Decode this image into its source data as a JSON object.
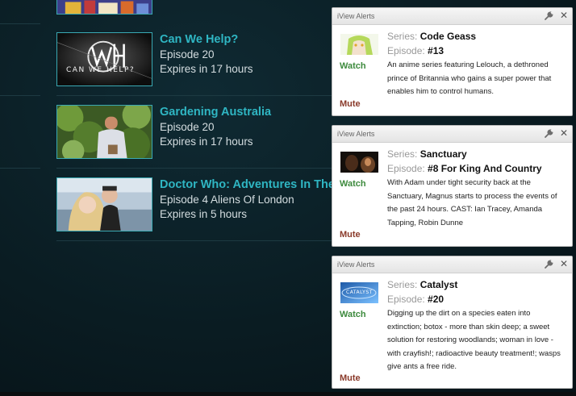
{
  "shows": [
    {
      "title": "",
      "episode": "",
      "expires": ""
    },
    {
      "title": "Can We Help?",
      "episode": "Episode 20",
      "expires": "Expires in 17 hours",
      "thumb_text": "CAN WE HELP?"
    },
    {
      "title": "Gardening Australia",
      "episode": "Episode 20",
      "expires": "Expires in 17 hours"
    },
    {
      "title": "Doctor Who: Adventures In The",
      "episode": "Episode 4 Aliens Of London",
      "expires": "Expires in 5 hours"
    }
  ],
  "alerts": [
    {
      "header": "iView Alerts",
      "series_label": "Series:",
      "series": "Code Geass",
      "episode_label": "Episode:",
      "episode": "#13",
      "watch": "Watch",
      "mute": "Mute",
      "description": "An anime series featuring Lelouch, a dethroned prince of Britannia who gains a super power that enables him to control humans."
    },
    {
      "header": "iView Alerts",
      "series_label": "Series:",
      "series": "Sanctuary",
      "episode_label": "Episode:",
      "episode": "#8 For King And Country",
      "watch": "Watch",
      "mute": "Mute",
      "description": "With Adam under tight security back at the Sanctuary, Magnus starts to process the events of the past 24 hours. CAST: Ian Tracey, Amanda Tapping, Robin Dunne"
    },
    {
      "header": "iView Alerts",
      "series_label": "Series:",
      "series": "Catalyst",
      "episode_label": "Episode:",
      "episode": "#20",
      "watch": "Watch",
      "mute": "Mute",
      "description": "Digging up the dirt on a species eaten into extinction; botox - more than skin deep; a sweet solution for restoring woodlands; woman in love - with crayfish!; radioactive beauty treatment!; wasps give ants a free ride.",
      "thumb_text": "CATALYST"
    }
  ],
  "icons": {
    "settings": "wrench-icon",
    "close": "close-icon",
    "close_glyph": "✕"
  },
  "colors": {
    "show_title": "#2fb6c3",
    "watch": "#3d8a3d",
    "mute": "#8a3a2a"
  }
}
